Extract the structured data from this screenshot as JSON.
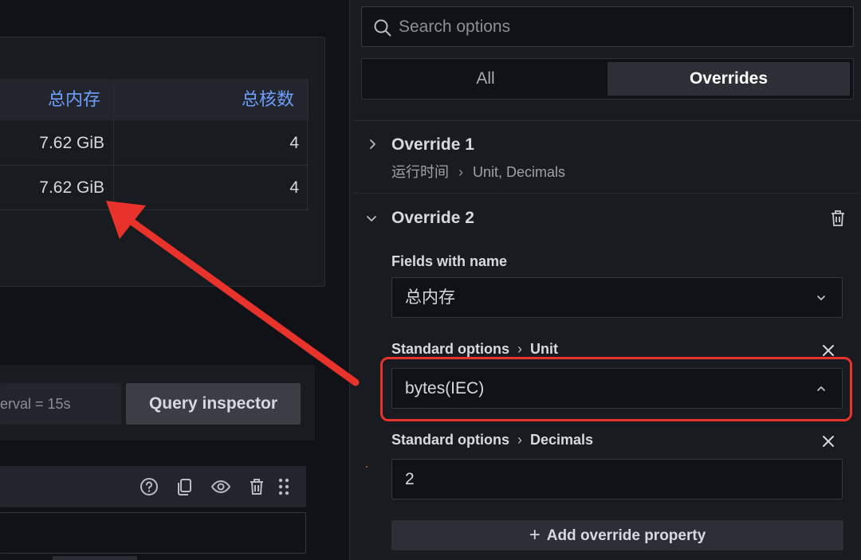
{
  "table": {
    "headers": [
      "总内存",
      "总核数"
    ],
    "rows": [
      [
        "7.62 GiB",
        "4"
      ],
      [
        "7.62 GiB",
        "4"
      ]
    ]
  },
  "query": {
    "interval_text": "erval = 15s",
    "inspector_label": "Query inspector"
  },
  "options": {
    "search_placeholder": "Search options",
    "tabs": [
      {
        "label": "All",
        "active": false
      },
      {
        "label": "Overrides",
        "active": true
      }
    ],
    "override1": {
      "title": "Override 1",
      "field": "运行时间",
      "props": "Unit, Decimals"
    },
    "override2": {
      "title": "Override 2",
      "matcher_label": "Fields with name",
      "matcher_value": "总内存",
      "properties": [
        {
          "group": "Standard options",
          "name": "Unit",
          "value": "bytes(IEC)"
        },
        {
          "group": "Standard options",
          "name": "Decimals",
          "value": "2"
        }
      ]
    },
    "add_property_label": "Add override property"
  },
  "colors": {
    "accent_header": "#6e9fff",
    "highlight": "#e8322c",
    "annotation_arrow": "#e8322c"
  }
}
